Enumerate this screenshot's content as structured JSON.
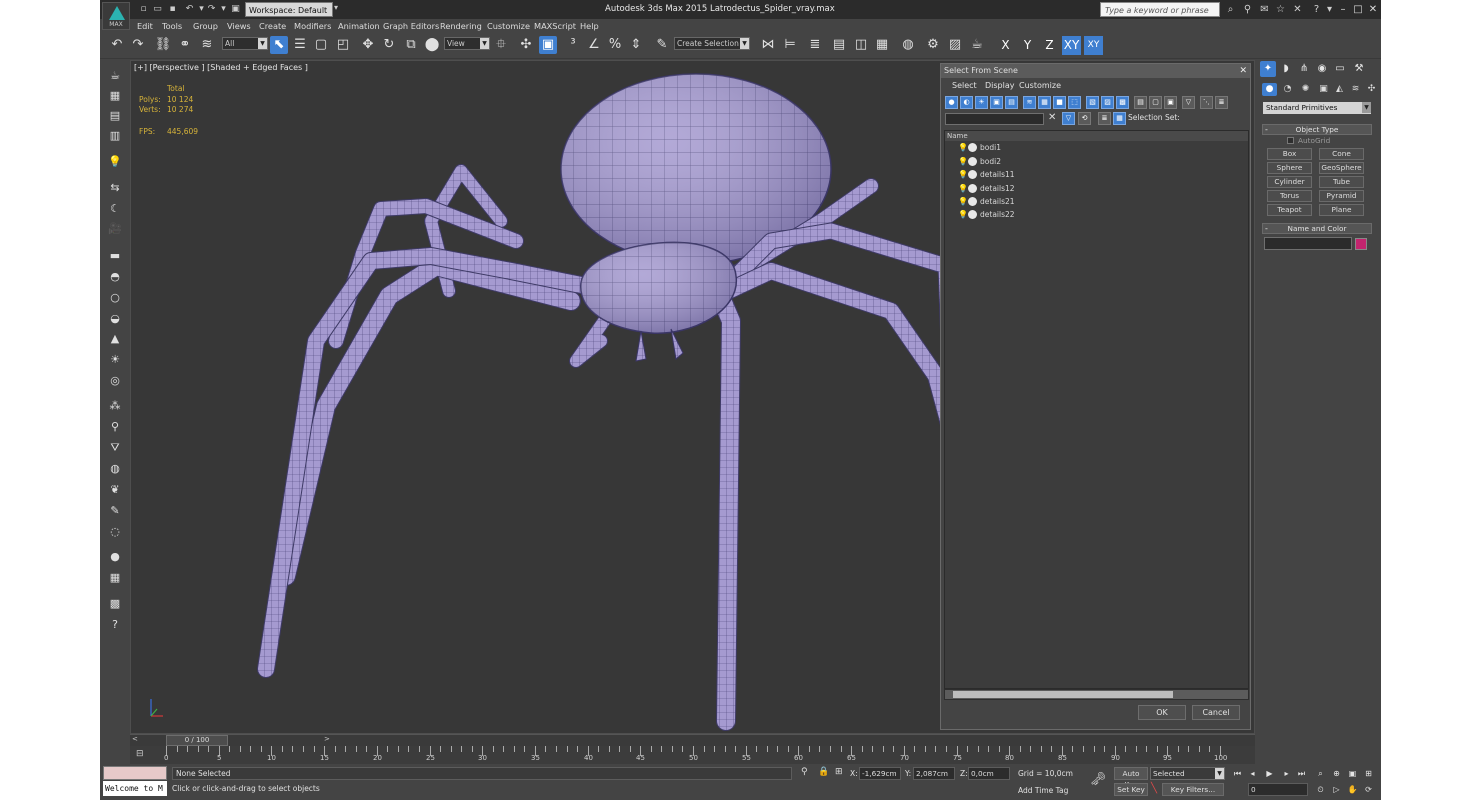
{
  "title_bar": {
    "logo_label": "MAX",
    "workspace": "Workspace: Default",
    "app_title": "Autodesk 3ds Max  2015     Latrodectus_Spider_vray.max",
    "search_placeholder": "Type a keyword or phrase"
  },
  "menu": [
    "Edit",
    "Tools",
    "Group",
    "Views",
    "Create",
    "Modifiers",
    "Animation",
    "Graph Editors",
    "Rendering",
    "Customize",
    "MAXScript",
    "Help"
  ],
  "toolbar": {
    "filter_value": "All",
    "refcoord_value": "View",
    "selection_set_value": "Create Selection Se",
    "axes": [
      "X",
      "Y",
      "Z",
      "XY",
      "XY"
    ]
  },
  "viewport": {
    "label": "[+] [Perspective ] [Shaded + Edged Faces ]",
    "stats": {
      "total_label": "Total",
      "polys_label": "Polys:",
      "polys_value": "10 124",
      "verts_label": "Verts:",
      "verts_value": "10 274",
      "fps_label": "FPS:",
      "fps_value": "445,609"
    },
    "mesh_color": "#a59ad0",
    "wire_color": "#4a4478"
  },
  "scene_explorer": {
    "title": "Select From Scene",
    "menus": [
      "Select",
      "Display",
      "Customize"
    ],
    "selection_set_label": "Selection Set:",
    "column_header": "Name",
    "objects": [
      "bodi1",
      "bodi2",
      "details11",
      "details12",
      "details21",
      "details22"
    ],
    "ok_label": "OK",
    "cancel_label": "Cancel"
  },
  "command_panel": {
    "category": "Standard Primitives",
    "object_type_header": "Object Type",
    "autogrid_label": "AutoGrid",
    "primitives": [
      "Box",
      "Cone",
      "Sphere",
      "GeoSphere",
      "Cylinder",
      "Tube",
      "Torus",
      "Pyramid",
      "Teapot",
      "Plane"
    ],
    "name_color_header": "Name and Color",
    "object_color": "#c2246e"
  },
  "time_slider": {
    "position": "0 / 100",
    "ticks": [
      "0",
      "5",
      "10",
      "15",
      "20",
      "25",
      "30",
      "35",
      "40",
      "45",
      "50",
      "55",
      "60",
      "65",
      "70",
      "75",
      "80",
      "85",
      "90",
      "95",
      "100"
    ]
  },
  "status": {
    "maxscript_text": "Welcome to M",
    "selection_info": "None Selected",
    "prompt": "Click or click-and-drag to select objects",
    "x_label": "X:",
    "x_value": "-1,629cm",
    "y_label": "Y:",
    "y_value": "2,087cm",
    "z_label": "Z:",
    "z_value": "0,0cm",
    "grid": "Grid = 10,0cm",
    "add_time_tag": "Add Time Tag",
    "auto_key": "Auto Key",
    "set_key": "Set Key",
    "key_mode": "Selected",
    "key_filters": "Key Filters...",
    "frame": "0"
  }
}
